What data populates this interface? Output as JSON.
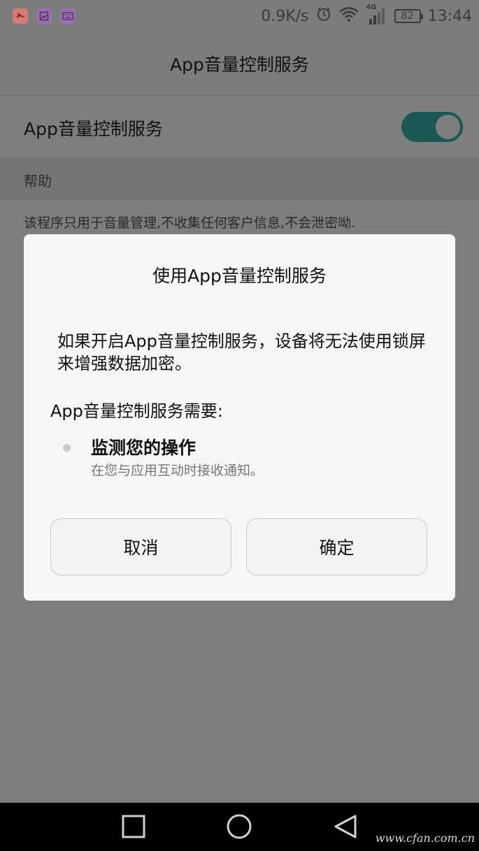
{
  "status_bar": {
    "apps": [
      "missed-call-icon",
      "gallery-icon",
      "keyboard-icon"
    ],
    "net_speed": "0.9K/s",
    "network_type": "4G",
    "battery": "82",
    "time": "13:44"
  },
  "header": {
    "title": "App音量控制服务"
  },
  "settings": {
    "service_label": "App音量控制服务",
    "toggle_on": true,
    "help_header": "帮助",
    "help_text": "该程序只用于音量管理,不收集任何客户信息,不会泄密呦."
  },
  "dialog": {
    "title": "使用App音量控制服务",
    "message": "如果开启App音量控制服务，设备将无法使用锁屏来增强数据加密。",
    "needs_label": "App音量控制服务需要:",
    "permission_title": "监测您的操作",
    "permission_desc": "在您与应用互动时接收通知。",
    "cancel_label": "取消",
    "ok_label": "确定"
  },
  "watermark": "www.cfan.com.cn",
  "colors": {
    "toggle_track": "#1b5753",
    "dim_background": "#7d7d7d",
    "dialog_background": "#f6f6f6"
  }
}
